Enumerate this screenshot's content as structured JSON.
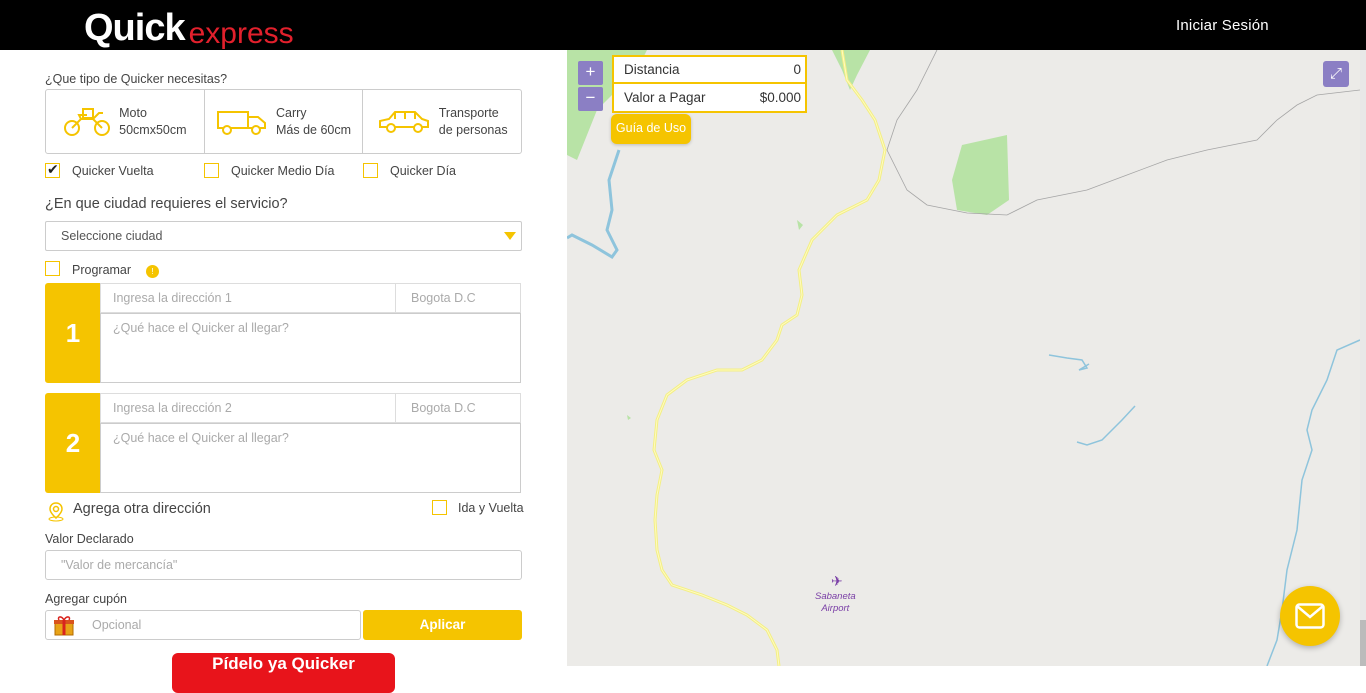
{
  "header": {
    "logo_quick": "Quick",
    "logo_express": "express",
    "login_label": "Iniciar Sesión"
  },
  "form": {
    "vehicle_question": "¿Que tipo de Quicker necesitas?",
    "vehicles": [
      {
        "line1": "Moto",
        "line2": "50cmx50cm",
        "icon": "motorcycle-icon"
      },
      {
        "line1": "Carry",
        "line2": "Más de 60cm",
        "icon": "van-icon"
      },
      {
        "line1": "Transporte",
        "line2": "de personas",
        "icon": "car-icon"
      }
    ],
    "service_options": [
      {
        "label": "Quicker Vuelta",
        "checked": true
      },
      {
        "label": "Quicker Medio Día",
        "checked": false
      },
      {
        "label": "Quicker Día",
        "checked": false
      }
    ],
    "city_question": "¿En que ciudad requieres el servicio?",
    "city_select_value": "Seleccione ciudad",
    "schedule_label": "Programar",
    "schedule_checked": false,
    "info_badge": "!",
    "stops": [
      {
        "number": "1",
        "address_placeholder": "Ingresa la dirección 1",
        "city_placeholder": "Bogota D.C",
        "note_placeholder": "¿Qué hace el Quicker al llegar?"
      },
      {
        "number": "2",
        "address_placeholder": "Ingresa la dirección 2",
        "city_placeholder": "Bogota D.C",
        "note_placeholder": "¿Qué hace el Quicker al llegar?"
      }
    ],
    "add_address_label": "Agrega otra dirección",
    "round_trip_label": "Ida y Vuelta",
    "round_trip_checked": false,
    "declared_value_label": "Valor Declarado",
    "declared_value_placeholder": "\"Valor de mercancía\"",
    "coupon_label": "Agregar cupón",
    "coupon_placeholder": "Opcional",
    "apply_label": "Aplicar",
    "order_label": "Pídelo ya Quicker"
  },
  "map": {
    "zoom_in": "+",
    "zoom_out": "−",
    "distance_label": "Distancia",
    "distance_value": "0",
    "price_label": "Valor a Pagar",
    "price_value": "$0.000",
    "guide_label": "Guía de Uso",
    "airport_line1": "Sabaneta",
    "airport_line2": "Airport"
  },
  "colors": {
    "brand_yellow": "#f5c400",
    "brand_red": "#e8141b",
    "header_bg": "#000000",
    "map_control": "#8b7fc4"
  }
}
